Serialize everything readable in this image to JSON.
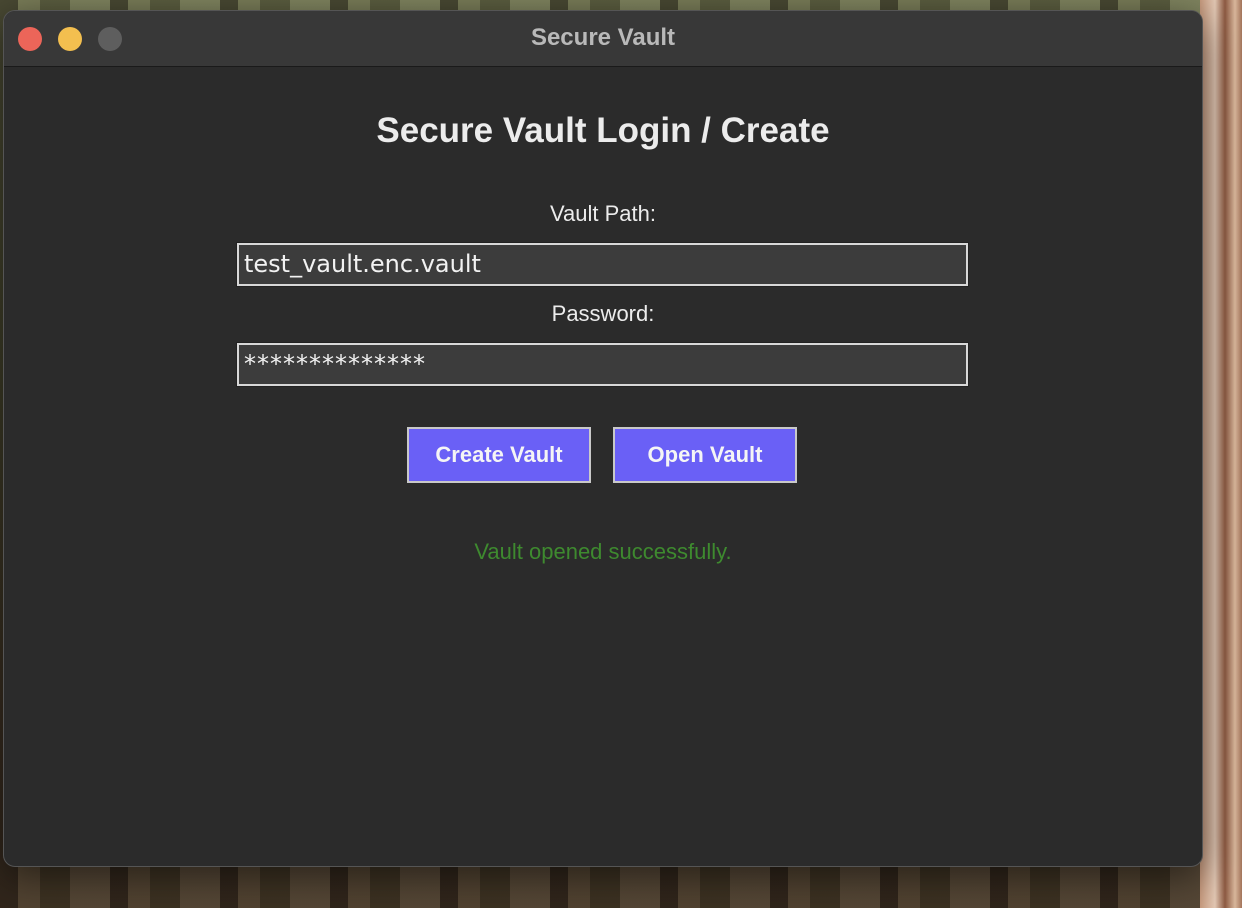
{
  "window": {
    "title": "Secure Vault"
  },
  "form": {
    "heading": "Secure Vault Login / Create",
    "vault_path_label": "Vault Path:",
    "vault_path_value": "test_vault.enc.vault",
    "password_label": "Password:",
    "password_masked": "**************"
  },
  "buttons": {
    "create_label": "Create Vault",
    "open_label": "Open Vault"
  },
  "status": {
    "message": "Vault opened successfully."
  },
  "colors": {
    "accent_button": "#6a60f6",
    "status_success": "#3e8a2f",
    "window_background": "#2b2b2b",
    "close_button": "#ec6559",
    "minimize_button": "#f3bf4f",
    "zoom_button_disabled": "#5e5e5e"
  },
  "icons": {
    "close": "close-icon",
    "minimize": "minimize-icon",
    "zoom": "zoom-icon"
  }
}
